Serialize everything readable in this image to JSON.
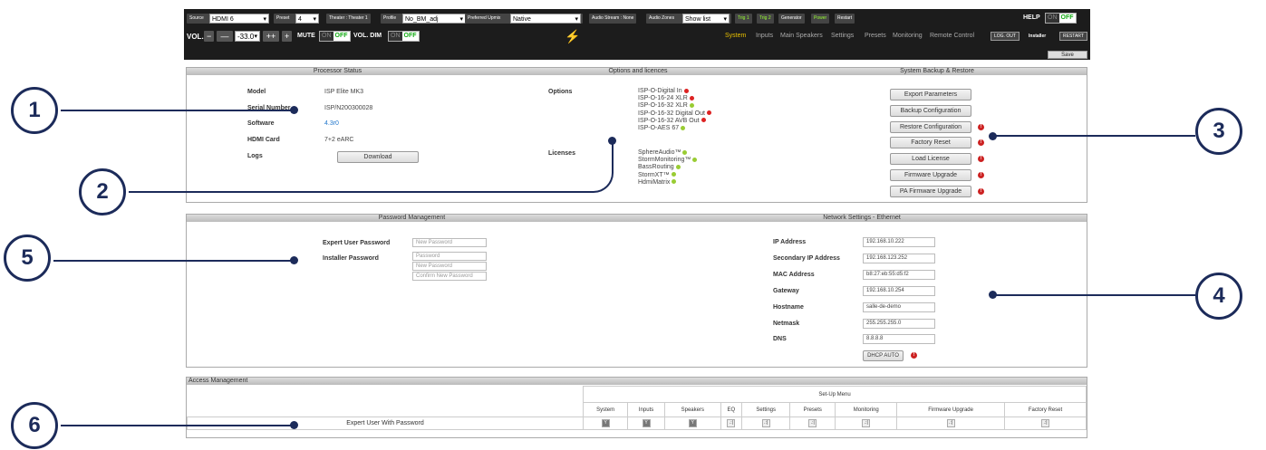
{
  "topbar": {
    "source_label": "Source",
    "source_value": "HDMI 6",
    "preset_label": "Preset",
    "preset_value": "4",
    "theater": "Theater : Theater 1",
    "profile_label": "Profile",
    "profile_value": "No_BM_adj",
    "upmix_label": "Preferred Upmix",
    "upmix_value": "Native",
    "audio_stream": "Audio Stream : None",
    "zones_label": "Audio Zones",
    "zones_value": "Show list",
    "trig1": "Trig 1",
    "trig2": "Trig 2",
    "generator": "Generator",
    "power": "Power",
    "restart_chip": "Restart",
    "help": "HELP",
    "on": "ON",
    "off": "OFF",
    "vol_label": "VOL.",
    "vol_minus": "−",
    "vol_mm": "—",
    "vol_value": "-33.0",
    "vol_pp": "++",
    "vol_plus": "+",
    "mute_label": "MUTE",
    "voldim_label": "VOL. DIM",
    "bolt": "⚡",
    "menu": [
      "System",
      "Inputs",
      "Main Speakers",
      "Settings",
      "Presets",
      "Monitoring",
      "Remote Control"
    ],
    "logout": "LOG. OUT",
    "installer": "Installer",
    "restart": "RESTART",
    "save": "Save"
  },
  "processor": {
    "title": "Processor Status",
    "model_label": "Model",
    "model": "ISP Elite MK3",
    "serial_label": "Serial Number",
    "serial": "ISP/N200300028",
    "software_label": "Software",
    "software": "4.3r0",
    "hdmi_label": "HDMI Card",
    "hdmi": "7+2 eARC",
    "logs_label": "Logs",
    "download": "Download"
  },
  "options": {
    "title": "Options and licences",
    "options_label": "Options",
    "items": [
      "ISP-O-Digital In",
      "ISP-O-16-24 XLR",
      "ISP-O-16-32 XLR",
      "ISP-O-16-32 Digital Out",
      "ISP-O-16-32 AVB Out",
      "ISP-O-AES 67"
    ],
    "item_status": [
      "red",
      "red",
      "green",
      "red",
      "red",
      "green"
    ],
    "licenses_label": "Licenses",
    "licenses": [
      "SphereAudio™",
      "StormMonitoring™",
      "BassRouting",
      "StormXT™",
      "HdmiMatrix"
    ]
  },
  "backup": {
    "title": "System Backup & Restore",
    "buttons": [
      "Export Parameters",
      "Backup Configuration",
      "Restore Configuration",
      "Factory Reset",
      "Load License",
      "Firmware Upgrade",
      "PA Firmware Upgrade"
    ]
  },
  "password": {
    "title": "Password Management",
    "expert_label": "Expert User Password",
    "expert_ph": "New Password",
    "installer_label": "Installer Password",
    "inst_ph1": "Password",
    "inst_ph2": "New Password",
    "inst_ph3": "Confirm New Password"
  },
  "network": {
    "title": "Network Settings - Ethernet",
    "rows": [
      {
        "label": "IP Address",
        "value": "192.168.10.222"
      },
      {
        "label": "Secondary IP Address",
        "value": "192.168.123.252"
      },
      {
        "label": "MAC Address",
        "value": "b8:27:eb:55:d5:f2"
      },
      {
        "label": "Gateway",
        "value": "192.168.10.254"
      },
      {
        "label": "Hostname",
        "value": "salle-de-demo"
      },
      {
        "label": "Netmask",
        "value": "255.255.255.0"
      },
      {
        "label": "DNS",
        "value": "8.8.8.8"
      }
    ],
    "dhcp": "DHCP AUTO"
  },
  "access": {
    "title": "Access Management",
    "setup_menu": "Set-Up Menu",
    "columns": [
      "System",
      "Inputs",
      "Speakers",
      "EQ",
      "Settings",
      "Presets",
      "Monitoring",
      "Firmware Upgrade",
      "Factory Reset"
    ],
    "row_label": "Expert User With Password",
    "row_checked": [
      true,
      true,
      true,
      false,
      false,
      false,
      false,
      false,
      false
    ]
  },
  "callouts": [
    "1",
    "2",
    "3",
    "4",
    "5",
    "6"
  ]
}
